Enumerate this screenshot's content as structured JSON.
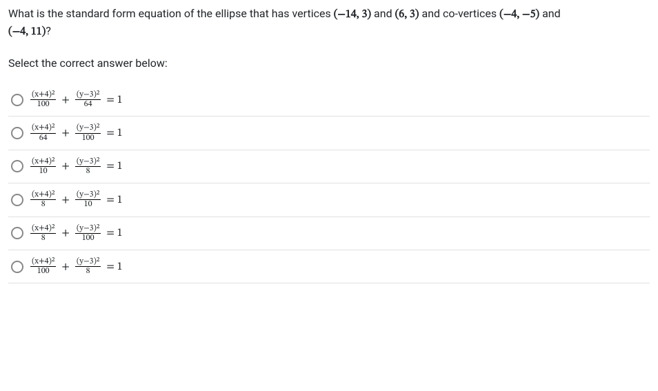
{
  "question": {
    "pre": "What is the standard form equation of the ellipse that has vertices ",
    "v1": "(−14, 3)",
    "and1": " and ",
    "v2": "(6, 3)",
    "mid": " and co-vertices ",
    "cv1": "(−4, −5)",
    "and2": " and ",
    "cv2": "(−4, 11)",
    "post": "?"
  },
  "prompt": "Select the correct answer below:",
  "options": [
    {
      "num1": "(x+4)²",
      "den1": "100",
      "num2": "(y−3)²",
      "den2": "64"
    },
    {
      "num1": "(x+4)²",
      "den1": "64",
      "num2": "(y−3)²",
      "den2": "100"
    },
    {
      "num1": "(x+4)²",
      "den1": "10",
      "num2": "(y−3)²",
      "den2": "8"
    },
    {
      "num1": "(x+4)²",
      "den1": "8",
      "num2": "(y−3)²",
      "den2": "10"
    },
    {
      "num1": "(x+4)²",
      "den1": "8",
      "num2": "(y−3)²",
      "den2": "100"
    },
    {
      "num1": "(x+4)²",
      "den1": "100",
      "num2": "(y−3)²",
      "den2": "8"
    }
  ],
  "symbols": {
    "plus": "+",
    "equals": "= 1"
  }
}
